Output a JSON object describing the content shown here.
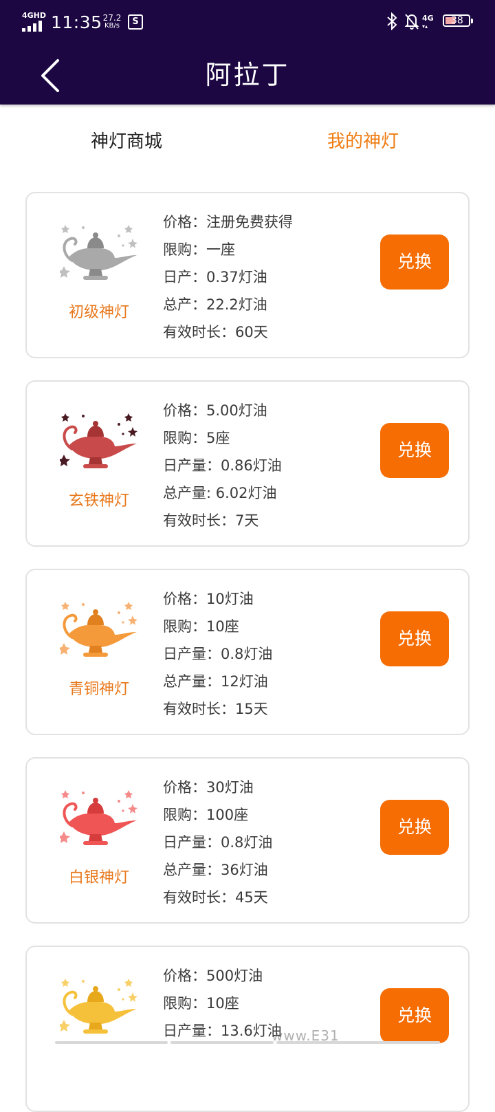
{
  "status_bar": {
    "network_label": "4GHD",
    "time": "11:35",
    "speed_value": "27.2",
    "speed_unit": "KB/s",
    "sim_icon_text": "S",
    "net_right": "4G",
    "net_right_sub": "▾▴",
    "battery": "38"
  },
  "header": {
    "title": "阿拉丁",
    "back_icon": "chevron-left-icon"
  },
  "tabs": [
    {
      "label": "神灯商城",
      "active": false
    },
    {
      "label": "我的神灯",
      "active": true
    }
  ],
  "colors": {
    "header_bg": "#1c0742",
    "accent": "#ef7d13",
    "button_bg": "#f66d04"
  },
  "lamps": [
    {
      "name": "初级神灯",
      "color": "#a9a9a9",
      "dark": "#8a8a8a",
      "star_color": "#c0c0c0",
      "lines": [
        "价格：注册免费获得",
        "限购：一座",
        "日产：0.37灯油",
        "总产：22.2灯油",
        "有效时长：60天"
      ],
      "button": "兑换"
    },
    {
      "name": "玄铁神灯",
      "color": "#c94a4a",
      "dark": "#a63434",
      "star_color": "#4a1a22",
      "lines": [
        "价格：5.00灯油",
        "限购：5座",
        "日产量：0.86灯油",
        "总产量: 6.02灯油",
        "有效时长：7天"
      ],
      "button": "兑换"
    },
    {
      "name": "青铜神灯",
      "color": "#f59a3b",
      "dark": "#e0801f",
      "star_color": "#f7b172",
      "lines": [
        "价格：10灯油",
        "限购：10座",
        "日产量：0.8灯油",
        "总产量：12灯油",
        "有效时长：15天"
      ],
      "button": "兑换"
    },
    {
      "name": "白银神灯",
      "color": "#f05555",
      "dark": "#d63c3c",
      "star_color": "#f48a8a",
      "lines": [
        "价格：30灯油",
        "限购：100座",
        "日产量：0.8灯油",
        "总产量：36灯油",
        "有效时长：45天"
      ],
      "button": "兑换"
    },
    {
      "name": "",
      "color": "#f6c13a",
      "dark": "#e8a81c",
      "star_color": "#f8d067",
      "lines": [
        "价格：500灯油",
        "限购：10座",
        "日产量：13.6灯油"
      ],
      "button": "兑换"
    }
  ],
  "watermark": "www.E31"
}
